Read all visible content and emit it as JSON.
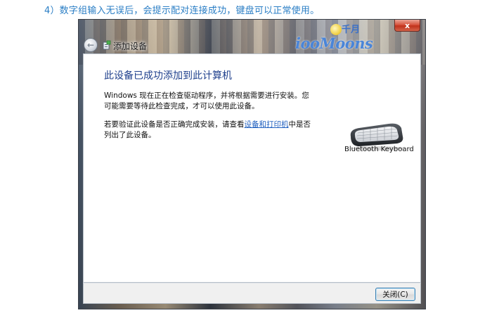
{
  "caption": "4）数字组输入无误后，会提示配对连接成功，键盘可以正常使用。",
  "window": {
    "title": "添加设备",
    "close_glyph": "x"
  },
  "watermark": {
    "top": "千月",
    "text": "iooMoons"
  },
  "content": {
    "heading": "此设备已成功添加到此计算机",
    "para1": "Windows 现在正在检查驱动程序，并将根据需要进行安装。您可能需要等待此检查完成，才可以使用此设备。",
    "para2_before": "若要验证此设备是否正确完成安装，请查看",
    "para2_link": "设备和打印机",
    "para2_after": "中是否列出了此设备。",
    "device_label": "Bluetooth Keyboard"
  },
  "footer": {
    "close_label": "关闭(C)"
  },
  "colors": {
    "caption": "#2a7ec5",
    "heading": "#1e3f8c",
    "link": "#1f5fbf"
  },
  "icons": [
    "back-arrow-icon",
    "device-wizard-icon",
    "keyboard-icon",
    "close-icon"
  ]
}
